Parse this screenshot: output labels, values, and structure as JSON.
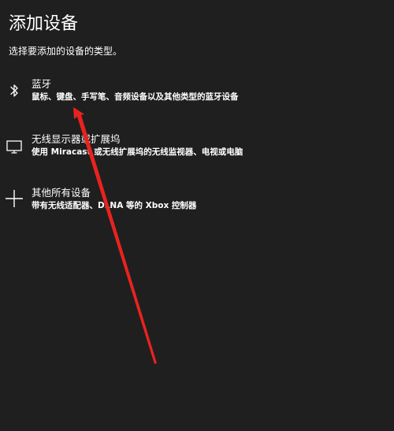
{
  "header": {
    "title": "添加设备",
    "subtitle": "选择要添加的设备的类型。"
  },
  "options": [
    {
      "name": "蓝牙",
      "description": "鼠标、键盘、手写笔、音频设备以及其他类型的蓝牙设备",
      "icon": "bluetooth-icon"
    },
    {
      "name": "无线显示器或扩展坞",
      "description": "使用 Miracast 或无线扩展坞的无线监视器、电视或电脑",
      "icon": "monitor-icon"
    },
    {
      "name": "其他所有设备",
      "description": "带有无线适配器、DLNA 等的 Xbox 控制器",
      "icon": "plus-icon"
    }
  ],
  "annotation": {
    "color": "#e8231f"
  }
}
